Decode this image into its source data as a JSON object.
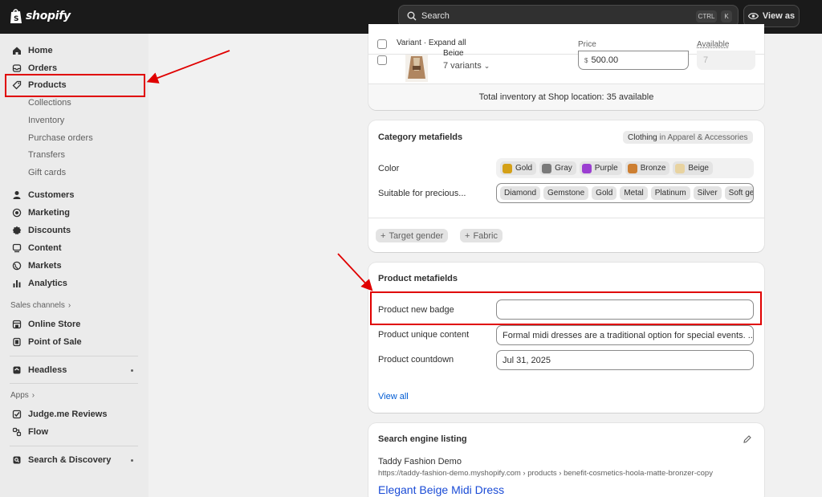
{
  "brand": {
    "name": "shopify"
  },
  "search": {
    "placeholder": "Search",
    "shortcut_ctrl": "CTRL",
    "shortcut_key": "K"
  },
  "topbar": {
    "view_as_label": "View as"
  },
  "sidebar": {
    "items": [
      {
        "label": "Home",
        "icon": "home-icon"
      },
      {
        "label": "Orders",
        "icon": "inbox-icon"
      },
      {
        "label": "Products",
        "icon": "tag-icon"
      },
      {
        "label": "Customers",
        "icon": "person-icon"
      },
      {
        "label": "Marketing",
        "icon": "target-icon"
      },
      {
        "label": "Discounts",
        "icon": "discount-icon"
      },
      {
        "label": "Content",
        "icon": "content-icon"
      },
      {
        "label": "Markets",
        "icon": "globe-icon"
      },
      {
        "label": "Analytics",
        "icon": "chart-icon"
      }
    ],
    "product_subitems": [
      "Collections",
      "Inventory",
      "Purchase orders",
      "Transfers",
      "Gift cards"
    ],
    "sales_channels_label": "Sales channels",
    "sales_channels": [
      {
        "label": "Online Store",
        "icon": "store-icon"
      },
      {
        "label": "Point of Sale",
        "icon": "pos-icon"
      }
    ],
    "headless_label": "Headless",
    "apps_label": "Apps",
    "apps": [
      {
        "label": "Judge.me Reviews",
        "icon": "judgeme-icon"
      },
      {
        "label": "Flow",
        "icon": "flow-icon"
      }
    ],
    "search_discovery_label": "Search & Discovery"
  },
  "variants": {
    "header_label": "Variant · Expand all",
    "price_header": "Price",
    "available_header": "Available",
    "row_name": "Beige",
    "row_variants": "7 variants",
    "currency_symbol": "$",
    "price_value": "500.00",
    "available_value": "7",
    "total_inventory": "Total inventory at Shop location: 35 available"
  },
  "category_metafields": {
    "title": "Category metafields",
    "category_badge_strong": "Clothing",
    "category_badge_rest": " in Apparel & Accessories",
    "color_label": "Color",
    "colors": [
      {
        "name": "Gold",
        "hex": "#d4a017"
      },
      {
        "name": "Gray",
        "hex": "#7a7a7a"
      },
      {
        "name": "Purple",
        "hex": "#9b3fd1"
      },
      {
        "name": "Bronze",
        "hex": "#cd7f32"
      },
      {
        "name": "Beige",
        "hex": "#e8d3a0"
      }
    ],
    "suitable_label": "Suitable for precious...",
    "suitable_tags": [
      "Diamond",
      "Gemstone",
      "Gold",
      "Metal",
      "Platinum",
      "Silver",
      "Soft gem"
    ],
    "add_target_gender": "Target gender",
    "add_fabric": "Fabric"
  },
  "product_metafields": {
    "title": "Product metafields",
    "new_badge_label": "Product new badge",
    "new_badge_value": "",
    "unique_content_label": "Product unique content",
    "unique_content_value": "Formal midi dresses are a traditional option for special events. ...",
    "countdown_label": "Product countdown",
    "countdown_value": "Jul 31, 2025",
    "view_all": "View all"
  },
  "seo": {
    "title": "Search engine listing",
    "store_name": "Taddy Fashion Demo",
    "url": "https://taddy-fashion-demo.myshopify.com › products › benefit-cosmetics-hoola-matte-bronzer-copy",
    "page_title": "Elegant Beige Midi Dress"
  },
  "colors": {
    "annotation_red": "#e00000",
    "link_blue": "#005bd3",
    "topbar": "#1a1a1a"
  }
}
